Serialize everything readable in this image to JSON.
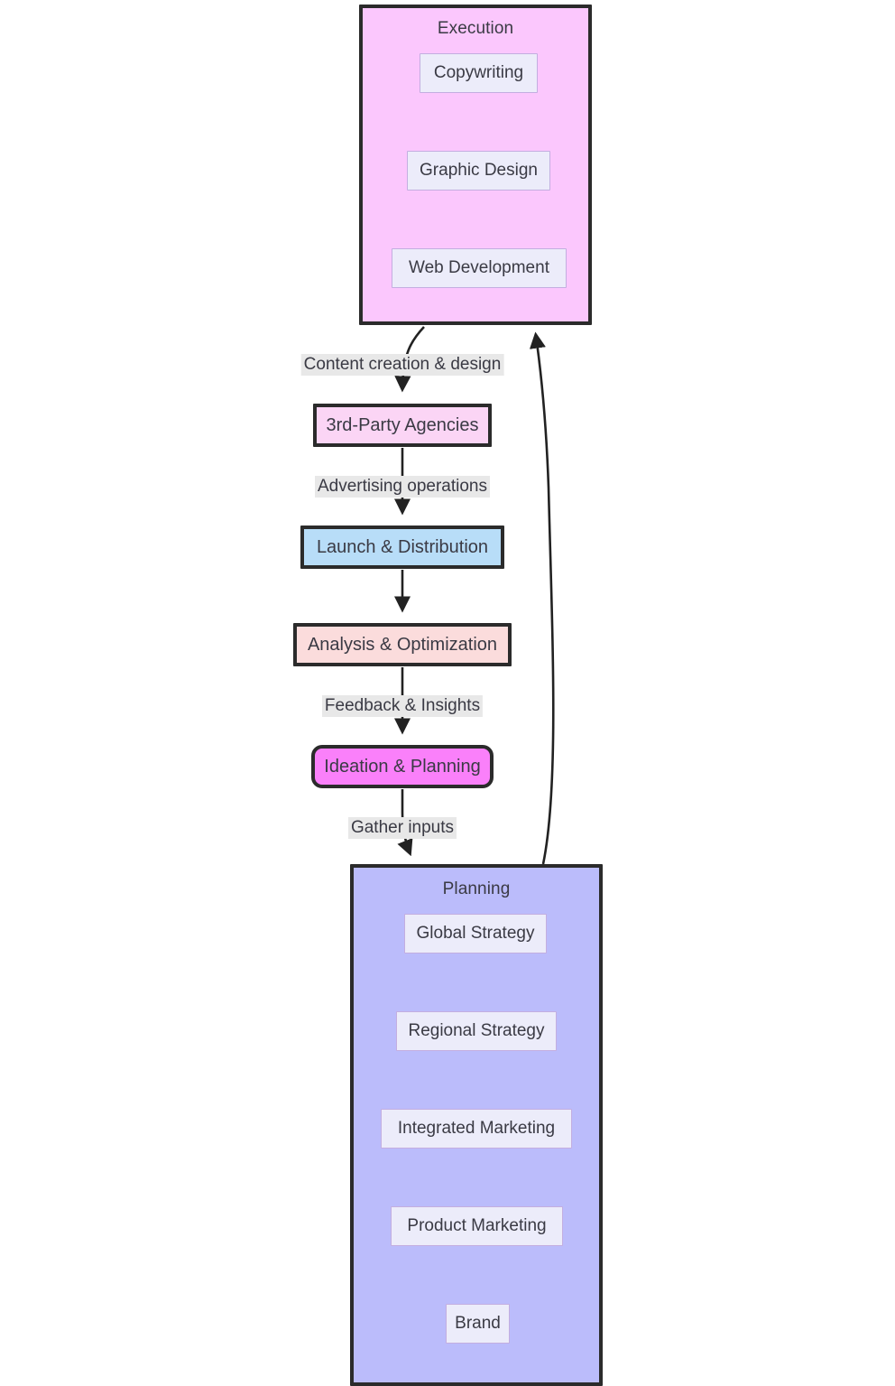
{
  "diagram": {
    "type": "flowchart",
    "direction": "top-to-bottom",
    "clusters": [
      {
        "id": "execution",
        "title": "Execution",
        "fill": "#FBC7FD",
        "stroke": "#2b2b2b",
        "nodes": [
          {
            "id": "copywriting",
            "label": "Copywriting"
          },
          {
            "id": "graphic-design",
            "label": "Graphic Design"
          },
          {
            "id": "web-development",
            "label": "Web Development"
          }
        ]
      },
      {
        "id": "planning",
        "title": "Planning",
        "fill": "#BBBCFB",
        "stroke": "#2b2b2b",
        "nodes": [
          {
            "id": "global-strategy",
            "label": "Global Strategy"
          },
          {
            "id": "regional-strategy",
            "label": "Regional Strategy"
          },
          {
            "id": "integrated-marketing",
            "label": "Integrated Marketing"
          },
          {
            "id": "product-marketing",
            "label": "Product Marketing"
          },
          {
            "id": "brand",
            "label": "Brand"
          }
        ]
      }
    ],
    "nodes": [
      {
        "id": "third-party-agencies",
        "label": "3rd-Party Agencies",
        "fill": "#FBD5F5",
        "stroke": "#2b2b2b",
        "shape": "rect"
      },
      {
        "id": "launch-distribution",
        "label": "Launch & Distribution",
        "fill": "#B8DDF8",
        "stroke": "#2b2b2b",
        "shape": "rect"
      },
      {
        "id": "analysis-optimization",
        "label": "Analysis & Optimization",
        "fill": "#FBDCDC",
        "stroke": "#2b2b2b",
        "shape": "rect"
      },
      {
        "id": "ideation-planning",
        "label": "Ideation & Planning",
        "fill": "#FA80FA",
        "stroke": "#2b2b2b",
        "shape": "rounded-rect"
      }
    ],
    "edges": [
      {
        "id": "edge-content-creation",
        "from": "execution",
        "to": "third-party-agencies",
        "label": "Content creation & design"
      },
      {
        "id": "edge-advertising-ops",
        "from": "third-party-agencies",
        "to": "launch-distribution",
        "label": "Advertising operations"
      },
      {
        "id": "edge-launch-to-analysis",
        "from": "launch-distribution",
        "to": "analysis-optimization",
        "label": ""
      },
      {
        "id": "edge-feedback-insights",
        "from": "analysis-optimization",
        "to": "ideation-planning",
        "label": "Feedback & Insights"
      },
      {
        "id": "edge-gather-inputs",
        "from": "ideation-planning",
        "to": "planning",
        "label": "Gather inputs"
      },
      {
        "id": "edge-planning-to-execution",
        "from": "planning",
        "to": "execution",
        "label": ""
      }
    ],
    "edge_label_background": "#E8E8E8",
    "subnode_fill": "#ECECFA",
    "subnode_stroke": "#c3aee0",
    "edge_stroke": "#222222",
    "text_color": "#3a3a44"
  }
}
